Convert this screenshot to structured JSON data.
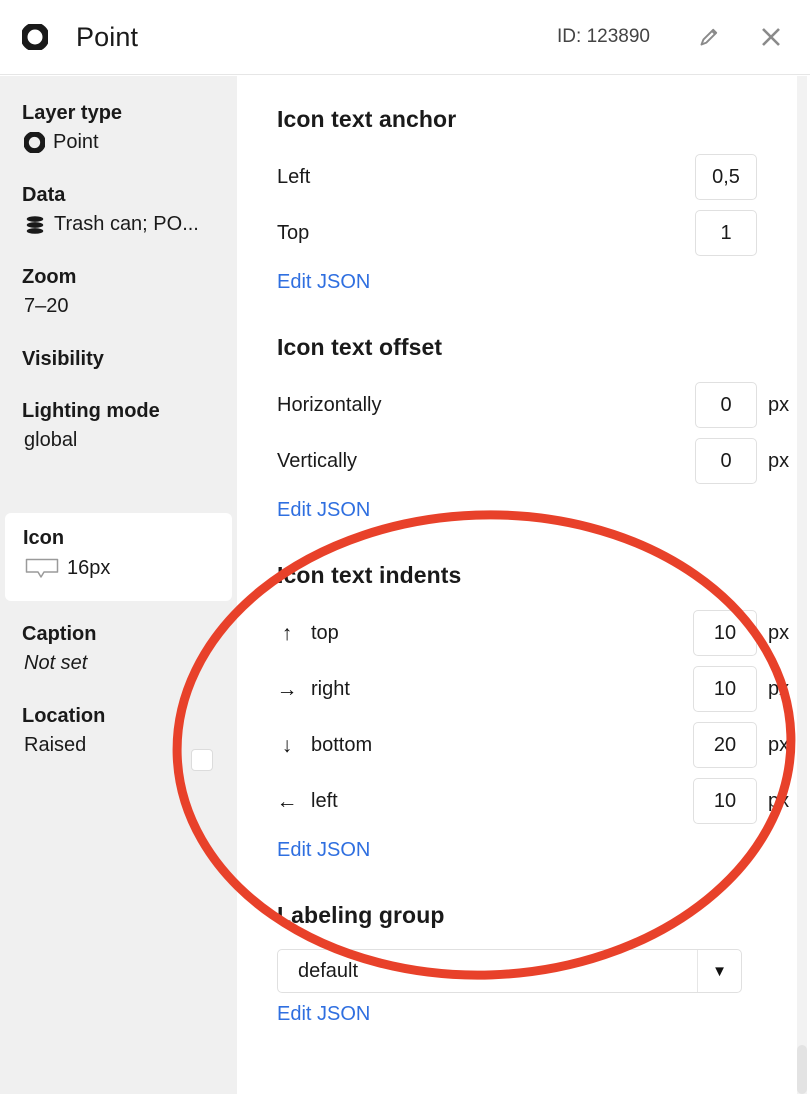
{
  "header": {
    "point_icon": "point-donut-icon",
    "title": "Point",
    "id_label": "ID: 123890",
    "edit_icon": "pencil-icon",
    "close_icon": "close-icon"
  },
  "sidebar": {
    "groups": [
      {
        "label": "Layer type",
        "value": "Point",
        "icon": "point-donut-icon"
      },
      {
        "label": "Data",
        "value": "Trash can; PO...",
        "icon": "database-icon"
      },
      {
        "label": "Zoom",
        "value": "7–20",
        "icon": null
      },
      {
        "label": "Visibility",
        "value": "",
        "icon": null
      },
      {
        "label": "Lighting mode",
        "value": "global",
        "icon": null
      }
    ],
    "card": {
      "label": "Icon",
      "value": "16px",
      "icon": "callout-bubble-icon"
    },
    "after_card": [
      {
        "label": "Caption",
        "value": "Not set",
        "italic": true
      },
      {
        "label": "Location",
        "value": "Raised",
        "italic": false
      }
    ],
    "raised_checkbox": {
      "checked": false
    }
  },
  "main": {
    "sections": [
      {
        "title": "Icon text anchor",
        "rows": [
          {
            "arrow": "",
            "label": "Left",
            "value": "0,5",
            "unit": ""
          },
          {
            "arrow": "",
            "label": "Top",
            "value": "1",
            "unit": ""
          }
        ],
        "edit_json": "Edit JSON"
      },
      {
        "title": "Icon text offset",
        "rows": [
          {
            "arrow": "",
            "label": "Horizontally",
            "value": "0",
            "unit": "px"
          },
          {
            "arrow": "",
            "label": "Vertically",
            "value": "0",
            "unit": "px"
          }
        ],
        "edit_json": "Edit JSON"
      },
      {
        "title": "Icon text indents",
        "rows": [
          {
            "arrow": "↑",
            "arrow_icon": "arrow-up-icon",
            "label": "top",
            "value": "10",
            "unit": "px"
          },
          {
            "arrow": "→",
            "arrow_icon": "arrow-right-icon",
            "label": "right",
            "value": "10",
            "unit": "px"
          },
          {
            "arrow": "↓",
            "arrow_icon": "arrow-down-icon",
            "label": "bottom",
            "value": "20",
            "unit": "px"
          },
          {
            "arrow": "←",
            "arrow_icon": "arrow-left-icon",
            "label": "left",
            "value": "10",
            "unit": "px"
          }
        ],
        "edit_json": "Edit JSON"
      }
    ],
    "labeling_group": {
      "title": "Labeling group",
      "selected": "default",
      "caret_icon": "chevron-down-icon",
      "edit_json": "Edit JSON"
    }
  },
  "annotation": {
    "shape": "ellipse",
    "color": "#e8412a",
    "stroke_width": 9
  },
  "colors": {
    "link": "#2f6fe0",
    "sidebar_bg": "#f0f0f0",
    "accent_red": "#e8412a",
    "text": "#1a1a1a",
    "border": "#e0e0e0"
  }
}
